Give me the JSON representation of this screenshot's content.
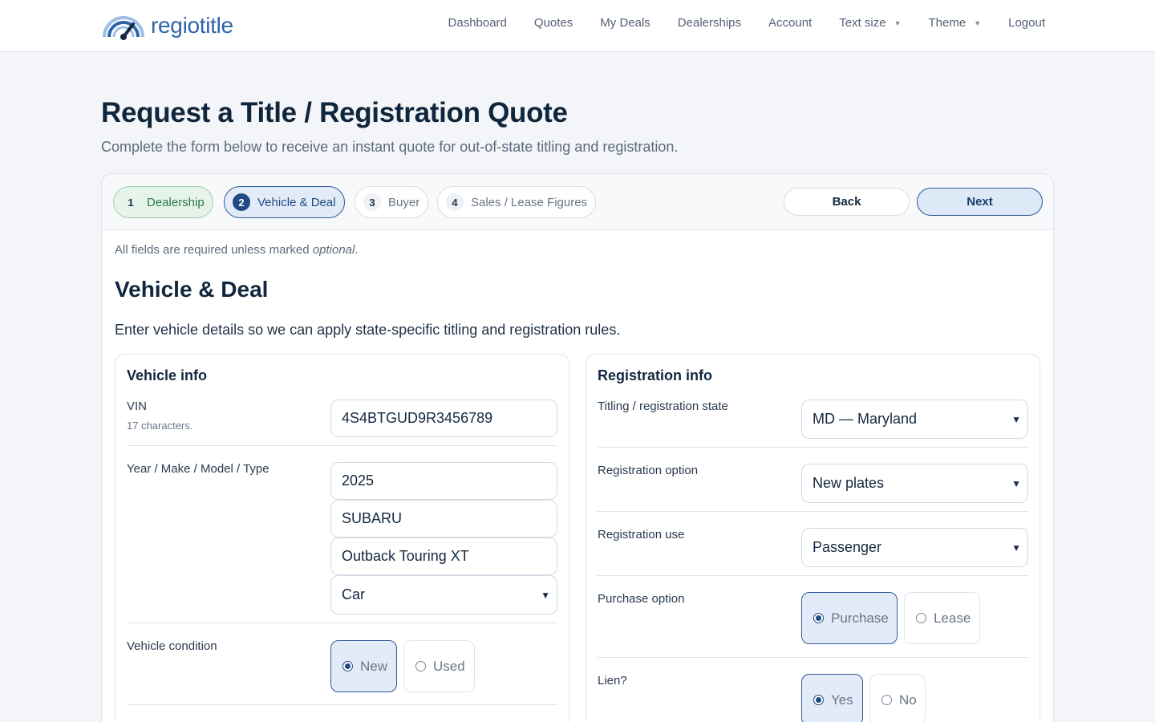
{
  "header": {
    "logo_text": "regiotitle",
    "nav": {
      "dashboard": "Dashboard",
      "quotes": "Quotes",
      "my_deals": "My Deals",
      "dealerships": "Dealerships",
      "account": "Account",
      "text_size": "Text size",
      "theme": "Theme",
      "logout": "Logout"
    }
  },
  "page": {
    "title": "Request a Title / Registration Quote",
    "subtitle": "Complete the form below to receive an instant quote for out-of-state titling and registration."
  },
  "stepper": {
    "steps": [
      {
        "num": "1",
        "label": "Dealership",
        "state": "done"
      },
      {
        "num": "2",
        "label": "Vehicle & Deal",
        "state": "active"
      },
      {
        "num": "3",
        "label": "Buyer",
        "state": "pending"
      },
      {
        "num": "4",
        "label": "Sales / Lease Figures",
        "state": "pending"
      }
    ],
    "back_label": "Back",
    "next_label": "Next"
  },
  "form": {
    "required_note": "All fields are required unless marked",
    "required_note_em": "optional",
    "required_note_end": ".",
    "section_title": "Vehicle & Deal",
    "section_desc": "Enter vehicle details so we can apply state-specific titling and registration rules.",
    "vehicle": {
      "title": "Vehicle info",
      "vin_label": "VIN",
      "vin_hint": "17 characters.",
      "vin_value": "4S4BTGUD9R3456789",
      "ymmt_label": "Year / Make / Model / Type",
      "year": "2025",
      "make": "SUBARU",
      "model": "Outback Touring XT",
      "type": "Car",
      "condition_label": "Vehicle condition",
      "condition_new": "New",
      "condition_used": "Used",
      "condition_selected": "New"
    },
    "registration": {
      "title": "Registration info",
      "state_label": "Titling / registration state",
      "state_value": "MD — Maryland",
      "option_label": "Registration option",
      "option_value": "New plates",
      "use_label": "Registration use",
      "use_value": "Passenger",
      "purchase_label": "Purchase option",
      "purchase_purchase": "Purchase",
      "purchase_lease": "Lease",
      "purchase_selected": "Purchase",
      "lien_label": "Lien?",
      "lien_yes": "Yes",
      "lien_no": "No",
      "lien_selected": "Yes"
    }
  },
  "colors": {
    "brand": "#2e64a8",
    "primary": "#1f4a85",
    "success": "#2c7a49"
  }
}
